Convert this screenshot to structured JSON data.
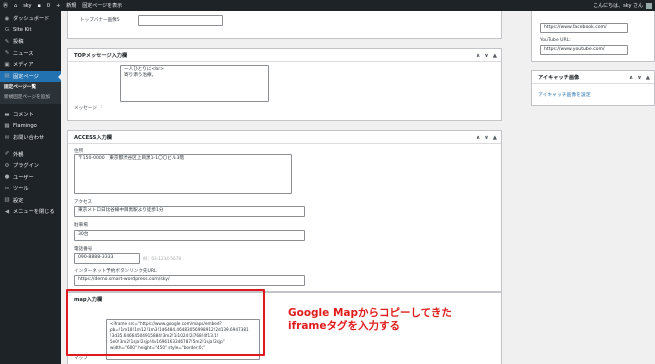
{
  "admin_bar": {
    "wp_logo": "wordpress-icon",
    "site_name": "sky",
    "comments_count": "0",
    "new_label": "新規",
    "view_label": "固定ページを表示",
    "greeting": "こんにちは、sky さん"
  },
  "sidebar": {
    "items": [
      {
        "icon": "dashboard-icon",
        "glyph": "◉",
        "label": "ダッシュボード"
      },
      {
        "icon": "sitekit-icon",
        "glyph": "G",
        "label": "Site Kit"
      },
      {
        "icon": "pin-icon",
        "glyph": "✎",
        "label": "投稿"
      },
      {
        "icon": "pin-icon",
        "glyph": "✎",
        "label": "ニュース"
      },
      {
        "icon": "media-icon",
        "glyph": "▣",
        "label": "メディア"
      },
      {
        "icon": "page-icon",
        "glyph": "▤",
        "label": "固定ページ"
      }
    ],
    "submenu": [
      "固定ページ一覧",
      "新規固定ページを追加"
    ],
    "items2": [
      {
        "icon": "comment-icon",
        "glyph": "▬",
        "label": "コメント"
      },
      {
        "icon": "flamingo-icon",
        "glyph": "▦",
        "label": "Flamingo"
      },
      {
        "icon": "mail-icon",
        "glyph": "✉",
        "label": "お問い合わせ"
      }
    ],
    "items3": [
      {
        "icon": "brush-icon",
        "glyph": "✐",
        "label": "外観"
      },
      {
        "icon": "plugin-icon",
        "glyph": "⚙",
        "label": "プラグイン"
      },
      {
        "icon": "user-icon",
        "glyph": "●",
        "label": "ユーザー"
      },
      {
        "icon": "wrench-icon",
        "glyph": "✂",
        "label": "ツール"
      },
      {
        "icon": "settings-icon",
        "glyph": "▥",
        "label": "設定"
      },
      {
        "icon": "collapse-icon",
        "glyph": "◀",
        "label": "メニューを閉じる"
      }
    ]
  },
  "top_banner": {
    "label": "トップバナー画像5"
  },
  "top_message": {
    "title": "TOPメッセージ入力欄",
    "label": "メッセージ",
    "sep": ":",
    "value": "一人ひとりに<br>\n寄り添う治療。"
  },
  "access": {
    "title": "ACCESS入力欄",
    "address_label": "住所",
    "address_value": "〒150-0000　東京都渋谷区上目黒1-1〇〇ビル3階",
    "access_label": "アクセス",
    "access_value": "東京メトロ日比谷線中目黒駅より徒歩1分",
    "parking_label": "駐車場",
    "parking_value": "30台",
    "phone_label": "電話番号",
    "phone_value": "090-8888-3333",
    "phone_hint": "例：03-1234-5678",
    "reserve_label": "インターネット予約ボタンリンク先URL",
    "reserve_value": "https://demo.smart-wordpress.com/sky/"
  },
  "map": {
    "title": "map入力欄",
    "label": "マップ",
    "value": "<iframe src=\"https://www.google.com/maps/embed?\npb=!1m18!1m12!1m3!1d6484.46483056998912!2d139.6947381\n!3d35.64664504915884!3m2!1i1024!2i768!4f13.1!\n5e0!3m2!1sja!2sjp!4v1696163346787!5m2!1sja!2sjp\"\nwidth=\"600\" height=\"450\" style=\"border:0;\""
  },
  "social": {
    "facebook_value": "https://www.facebook.com/",
    "youtube_label": "YouTube URL:",
    "youtube_value": "https://www.youtube.com/"
  },
  "eyecatch": {
    "title": "アイキャッチ画像",
    "link": "アイキャッチ画像を設定"
  },
  "callout": {
    "line1": "Google Mapからコピーしてきた",
    "line2": "iframeタグを入力する"
  },
  "controls": {
    "up": "∧",
    "down": "∨",
    "toggle": "▲"
  },
  "colors": {
    "accent": "#2271b1",
    "highlight": "#e0191e",
    "sidebar": "#1d2327"
  }
}
